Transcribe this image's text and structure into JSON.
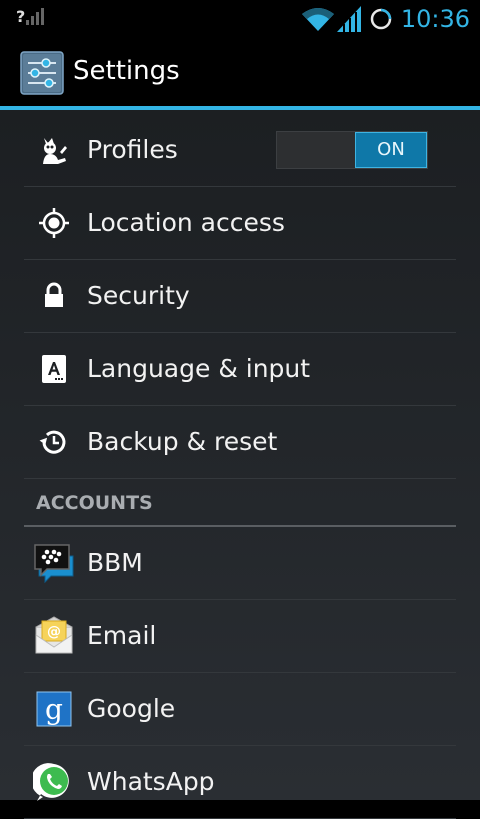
{
  "status_bar": {
    "signal_unknown": "?",
    "time": "10:36",
    "icons": [
      "no-signal-icon",
      "wifi-icon",
      "cell-signal-icon",
      "loading-icon"
    ]
  },
  "action_bar": {
    "title": "Settings",
    "icon": "settings-sliders-icon"
  },
  "settings": [
    {
      "label": "Profiles",
      "icon": "profiles-icon",
      "toggle": "ON"
    },
    {
      "label": "Location access",
      "icon": "location-icon"
    },
    {
      "label": "Security",
      "icon": "lock-icon"
    },
    {
      "label": "Language & input",
      "icon": "keyboard-a-icon"
    },
    {
      "label": "Backup & reset",
      "icon": "backup-restore-icon"
    }
  ],
  "accounts_header": "ACCOUNTS",
  "accounts": [
    {
      "label": "BBM",
      "icon": "bbm-icon"
    },
    {
      "label": "Email",
      "icon": "email-icon"
    },
    {
      "label": "Google",
      "icon": "google-icon",
      "glyph": "g"
    },
    {
      "label": "WhatsApp",
      "icon": "whatsapp-icon"
    }
  ],
  "colors": {
    "accent": "#33b5e5",
    "toggle_on": "#0f78a8",
    "background": "#1c1f22"
  }
}
